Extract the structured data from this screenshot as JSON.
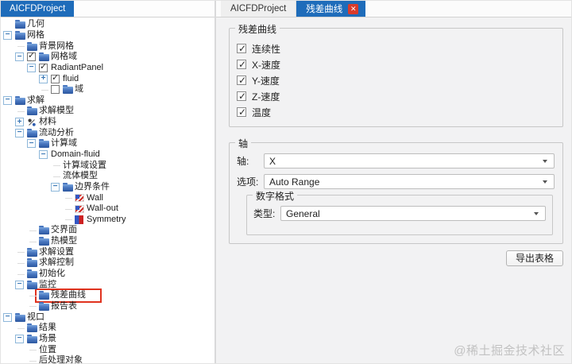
{
  "colors": {
    "accent": "#1e6cba",
    "close-red": "#da3b2b",
    "hl-red": "#e0331f",
    "panel-bg": "#f2f2f3"
  },
  "left_panel": {
    "tab": "AICFDProject",
    "tree": [
      {
        "label": "几何",
        "level": 0,
        "icon": "folder"
      },
      {
        "label": "网格",
        "level": 0,
        "expander": "minus",
        "icon": "folder"
      },
      {
        "label": "背景网格",
        "level": 1,
        "icon": "folder"
      },
      {
        "label": "网格域",
        "level": 1,
        "expander": "minus",
        "checkbox": "checked",
        "icon": "folder"
      },
      {
        "label": "RadiantPanel",
        "level": 2,
        "expander": "minus",
        "checkbox": "checked"
      },
      {
        "label": "fluid",
        "level": 3,
        "expander": "plus",
        "checkbox": "checked"
      },
      {
        "label": "域",
        "level": 3,
        "checkbox": "unchecked",
        "icon": "folder"
      },
      {
        "label": "求解",
        "level": 0,
        "expander": "minus",
        "icon": "folder"
      },
      {
        "label": "求解模型",
        "level": 1,
        "icon": "folder"
      },
      {
        "label": "材料",
        "level": 1,
        "expander": "plus",
        "icon": "material"
      },
      {
        "label": "流动分析",
        "level": 1,
        "expander": "minus",
        "icon": "folder"
      },
      {
        "label": "计算域",
        "level": 2,
        "expander": "minus",
        "icon": "folder"
      },
      {
        "label": "Domain-fluid",
        "level": 3,
        "expander": "minus"
      },
      {
        "label": "计算域设置",
        "level": 4
      },
      {
        "label": "流体模型",
        "level": 4
      },
      {
        "label": "边界条件",
        "level": 4,
        "expander": "minus",
        "icon": "folder"
      },
      {
        "label": "Wall",
        "level": 5,
        "icon": "wall"
      },
      {
        "label": "Wall-out",
        "level": 5,
        "icon": "wall"
      },
      {
        "label": "Symmetry",
        "level": 5,
        "icon": "symmetry"
      },
      {
        "label": "交界面",
        "level": 2,
        "icon": "folder"
      },
      {
        "label": "热模型",
        "level": 2,
        "icon": "folder"
      },
      {
        "label": "求解设置",
        "level": 1,
        "icon": "folder"
      },
      {
        "label": "求解控制",
        "level": 1,
        "icon": "folder"
      },
      {
        "label": "初始化",
        "level": 1,
        "icon": "folder"
      },
      {
        "label": "监控",
        "level": 1,
        "expander": "minus",
        "icon": "folder"
      },
      {
        "label": "残差曲线",
        "level": 2,
        "icon": "folder",
        "highlight": true
      },
      {
        "label": "报告表",
        "level": 2,
        "icon": "folder"
      },
      {
        "label": "视口",
        "level": 0,
        "expander": "minus",
        "icon": "folder"
      },
      {
        "label": "结果",
        "level": 1,
        "icon": "folder"
      },
      {
        "label": "场景",
        "level": 1,
        "expander": "minus",
        "icon": "folder"
      },
      {
        "label": "位置",
        "level": 2
      },
      {
        "label": "后处理对象",
        "level": 2
      }
    ]
  },
  "right_panel": {
    "tabs": [
      {
        "label": "AICFDProject",
        "active": false,
        "closable": false
      },
      {
        "label": "残差曲线",
        "active": true,
        "closable": true
      }
    ],
    "groups": {
      "residual": {
        "title": "残差曲线",
        "checkboxes": [
          {
            "label": "连续性",
            "checked": true
          },
          {
            "label": "X-速度",
            "checked": true
          },
          {
            "label": "Y-速度",
            "checked": true
          },
          {
            "label": "Z-速度",
            "checked": true
          },
          {
            "label": "温度",
            "checked": true
          }
        ]
      },
      "axis": {
        "title": "轴",
        "fields": [
          {
            "label": "轴:",
            "value": "X"
          },
          {
            "label": "选项:",
            "value": "Auto Range"
          }
        ],
        "number_format": {
          "title": "数字格式",
          "fields": [
            {
              "label": "类型:",
              "value": "General"
            }
          ]
        }
      }
    },
    "export_button": "导出表格"
  },
  "watermark": "@稀土掘金技术社区"
}
